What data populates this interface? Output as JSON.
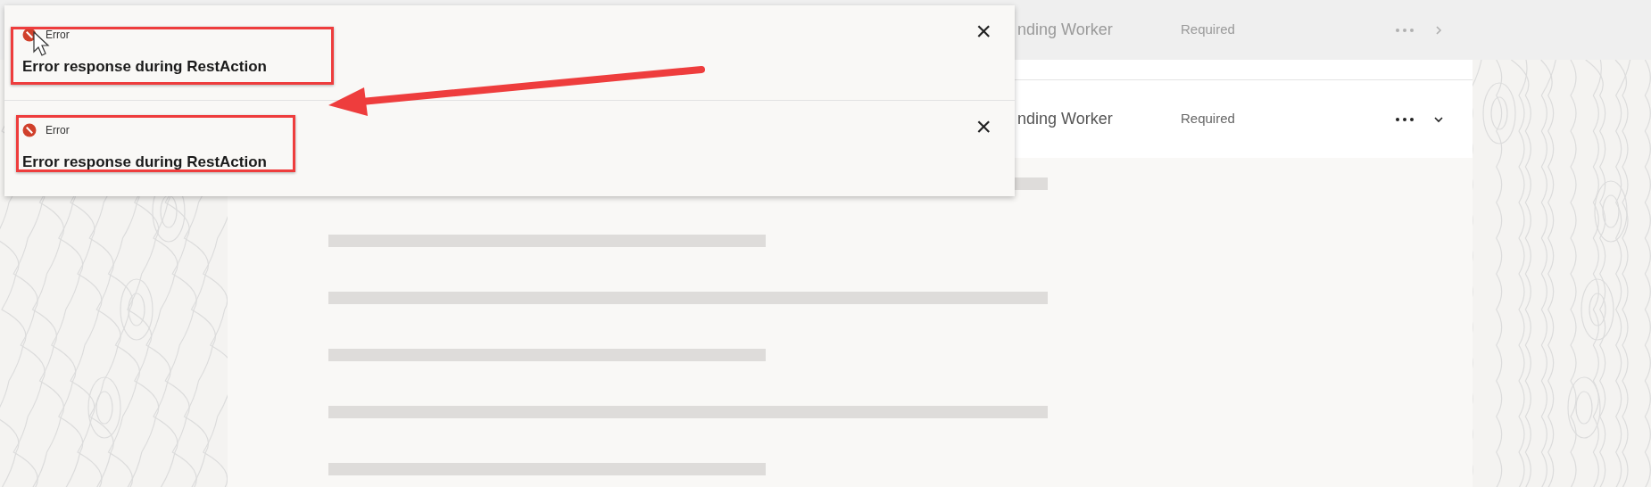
{
  "task_rows": [
    {
      "name": "nding Worker",
      "status": "Required",
      "dimmed": true,
      "expanded": false
    },
    {
      "name": "nding Worker",
      "status": "Required",
      "dimmed": false,
      "expanded": true
    }
  ],
  "skeleton_lines": [
    {
      "kind": "long"
    },
    {
      "kind": "short"
    },
    {
      "kind": "long"
    },
    {
      "kind": "short"
    },
    {
      "kind": "long"
    },
    {
      "kind": "short"
    }
  ],
  "toasts": [
    {
      "severity": "Error",
      "message": "Error response during RestAction",
      "close": "×"
    },
    {
      "severity": "Error",
      "message": "Error response during RestAction",
      "close": "×"
    }
  ]
}
